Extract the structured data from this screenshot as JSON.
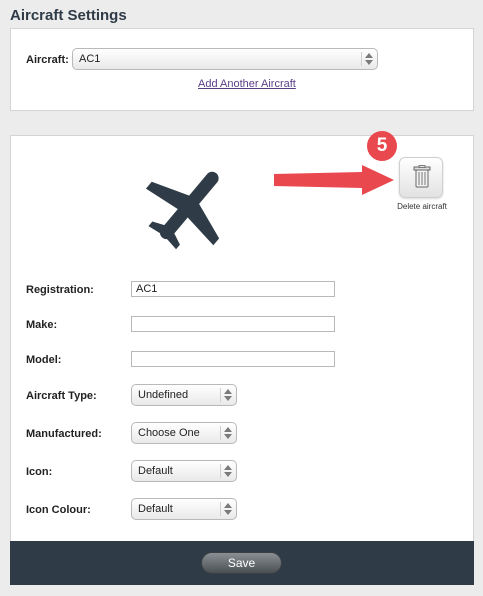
{
  "header": {
    "title": "Aircraft Settings"
  },
  "aircraft_selector": {
    "label": "Aircraft:",
    "selected": "AC1",
    "add_link": "Add Another Aircraft"
  },
  "delete": {
    "caption": "Delete aircraft",
    "icon": "trash-icon"
  },
  "annotation": {
    "step_number": "5",
    "color": "#e8484e"
  },
  "form": {
    "registration": {
      "label": "Registration:",
      "value": "AC1"
    },
    "make": {
      "label": "Make:",
      "value": ""
    },
    "model": {
      "label": "Model:",
      "value": ""
    },
    "aircraft_type": {
      "label": "Aircraft Type:",
      "selected": "Undefined"
    },
    "manufactured": {
      "label": "Manufactured:",
      "selected": "Choose One"
    },
    "icon": {
      "label": "Icon:",
      "selected": "Default"
    },
    "icon_colour": {
      "label": "Icon Colour:",
      "selected": "Default"
    }
  },
  "footer": {
    "save_label": "Save"
  },
  "colors": {
    "footer_bg": "#2f3b47",
    "plane": "#2f3b47",
    "link": "#5b3f86"
  }
}
